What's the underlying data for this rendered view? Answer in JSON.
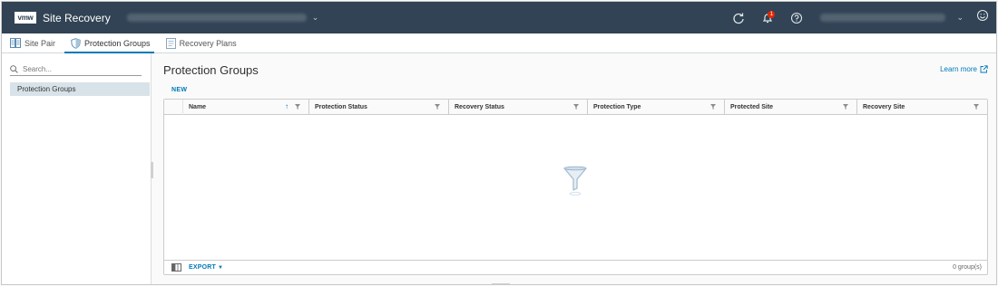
{
  "header": {
    "logo": "vmw",
    "title": "Site Recovery",
    "icons": [
      "refresh-icon",
      "bell-icon",
      "help-icon",
      "user-icon"
    ],
    "notification_count": "1"
  },
  "tabs": [
    {
      "label": "Site Pair",
      "icon": "site-pair-icon",
      "active": false
    },
    {
      "label": "Protection Groups",
      "icon": "shield-icon",
      "active": true
    },
    {
      "label": "Recovery Plans",
      "icon": "recovery-plan-icon",
      "active": false
    }
  ],
  "sidebar": {
    "search_placeholder": "Search...",
    "items": [
      {
        "label": "Protection Groups",
        "selected": true
      }
    ]
  },
  "main": {
    "title": "Protection Groups",
    "learn_more": "Learn more",
    "new_button": "NEW",
    "columns": [
      "Name",
      "Protection Status",
      "Recovery Status",
      "Protection Type",
      "Protected Site",
      "Recovery Site"
    ],
    "rows": [],
    "export_label": "EXPORT",
    "count_label": "0 group(s)"
  },
  "colors": {
    "header_bg": "#314354",
    "accent": "#0079b8",
    "selected_bg": "#d8e3e9",
    "badge": "#e62700"
  }
}
